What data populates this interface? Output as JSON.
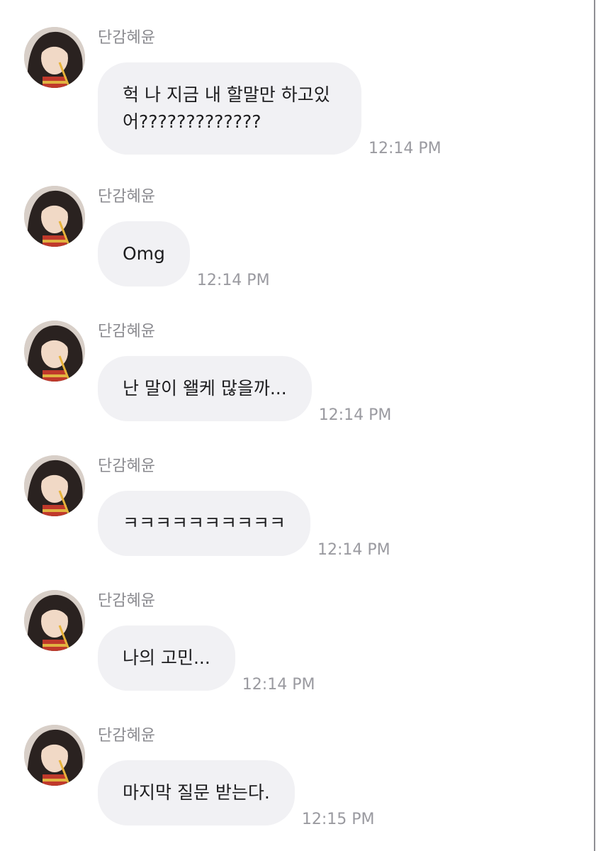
{
  "colors": {
    "bubble_background": "#f1f1f4",
    "message_text": "#1c1c1e",
    "meta_text": "#8a8a8f"
  },
  "avatar_icon": "profile-photo",
  "messages": [
    {
      "sender": "단감혜윤",
      "text": "헉 나 지금 내 할말만 하고있어?????????????",
      "time": "12:14 PM"
    },
    {
      "sender": "단감혜윤",
      "text": "Omg",
      "time": "12:14 PM"
    },
    {
      "sender": "단감혜윤",
      "text": "난 말이 왤케 많을까...",
      "time": "12:14 PM"
    },
    {
      "sender": "단감혜윤",
      "text": "ㅋㅋㅋㅋㅋㅋㅋㅋㅋㅋ",
      "time": "12:14 PM"
    },
    {
      "sender": "단감혜윤",
      "text": "나의 고민...",
      "time": "12:14 PM"
    },
    {
      "sender": "단감혜윤",
      "text": "마지막 질문 받는다.",
      "time": "12:15 PM"
    }
  ]
}
